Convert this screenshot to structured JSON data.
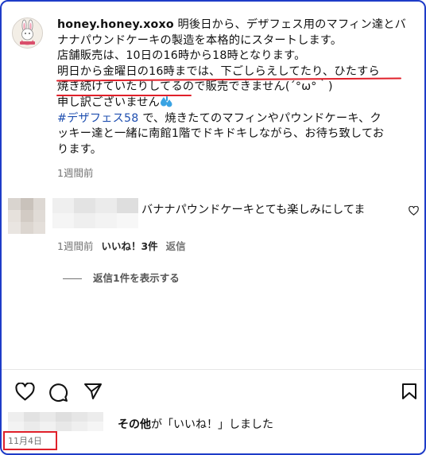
{
  "post": {
    "username": "honey.honey.xoxo",
    "caption_lines": [
      " 明後日から、デザフェス用のマフィン達とバ",
      "ナナパウンドケーキの製造を本格的にスタートします。",
      "店舗販売は、10日の16時から18時となります。",
      "明日から金曜日の16時までは、下ごしらえしてたり、ひたすら",
      "焼き続けていたりしてるので販売できません(´°ω°｀)",
      "申し訳ございません"
    ],
    "hashtag": "#デザフェス58",
    "caption_tail_lines": [
      " で、焼きたてのマフィンやパウンドケーキ、ク",
      "ッキー達と一緒に南館1階でドキドキしながら、お待ち致してお",
      "ります。"
    ],
    "time_ago": "1週間前"
  },
  "comment": {
    "text": "バナナパウンドケーキとても楽しみにしてま",
    "time_ago": "1週間前",
    "likes_label": "いいね！3件",
    "reply_label": "返信",
    "view_replies_label": "返信1件を表示する"
  },
  "likes": {
    "others_label": "その他",
    "suffix_label": "が「いいね！」しました"
  },
  "date": "11月4日",
  "icons": [
    "heart-icon",
    "comment-icon",
    "share-icon",
    "bookmark-icon",
    "drops-emoji-icon"
  ],
  "colors": {
    "frame": "#1e3cc8",
    "annotation": "#e0202a",
    "hashtag": "#1f4fb0",
    "muted": "#737373"
  }
}
